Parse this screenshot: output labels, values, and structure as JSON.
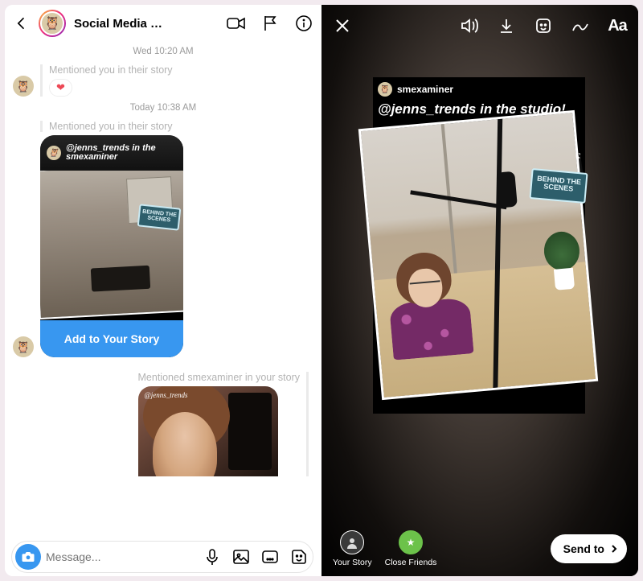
{
  "colors": {
    "ig_blue": "#3897f0",
    "cf_green": "#6cc24a",
    "arrow_red": "#ff2a1a"
  },
  "left": {
    "header_title": "Social Media …",
    "ts1": "Wed 10:20 AM",
    "mention1": "Mentioned you in their story",
    "heart": "❤",
    "ts2": "Today 10:38 AM",
    "mention2": "Mentioned you in their story",
    "story_author": "smexaminer",
    "story_caption_line": "@jenns_trends in the",
    "bts_line1": "BEHIND THE",
    "bts_line2": "SCENES",
    "add_to_story": "Add to Your Story",
    "mention3": "Mentioned smexaminer in your story",
    "thumb2_sig": "@jenns_trends",
    "compose_placeholder": "Message..."
  },
  "right": {
    "text_tool": "Aa",
    "reshare_author": "smexaminer",
    "caption": "@jenns_trends in the studio!",
    "bts_line1": "BEHIND THE",
    "bts_line2": "SCENES",
    "your_story": "Your Story",
    "close_friends": "Close Friends",
    "cf_star": "★",
    "send_to": "Send to"
  }
}
